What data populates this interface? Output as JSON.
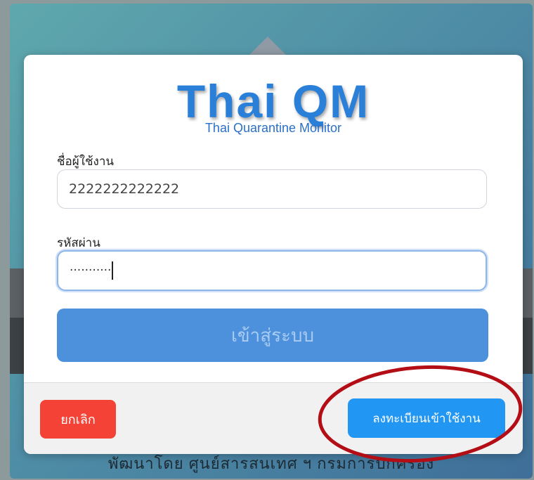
{
  "background": {
    "credit_text": "พัฒนาโดย ศูนย์สารสนเทศ ฯ กรมการปกครอง"
  },
  "logo": {
    "title": "Thai QM",
    "subtitle": "Thai Quarantine Monitor"
  },
  "form": {
    "username_label": "ชื่อผู้ใช้งาน",
    "username_value": "2222222222222",
    "password_label": "รหัสผ่าน",
    "password_masked": "···········",
    "login_button": "เข้าสู่ระบบ"
  },
  "footer": {
    "cancel_button": "ยกเลิก",
    "register_button": "ลงทะเบียนเข้าใช้งาน"
  },
  "colors": {
    "brand_blue": "#2a7fd9",
    "login_button": "#4d90dc",
    "cancel_button": "#f44336",
    "register_button": "#2196f3",
    "annotation_circle": "#b30d16"
  },
  "annotation": {
    "shape": "ellipse",
    "target": "register-button"
  }
}
